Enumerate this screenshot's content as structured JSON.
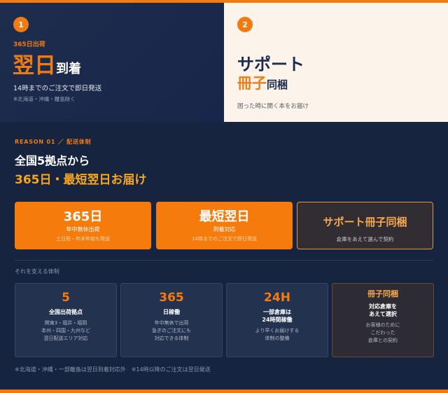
{
  "colors": {
    "accent": "#f07b12",
    "navy": "#16243f",
    "cream": "#fcf4ea",
    "gold": "#f5a623"
  },
  "panel_left": {
    "number": "1",
    "small": "365日出荷",
    "big_accent": "翌日",
    "big_rest": "到着",
    "sub": "14時までのご注文で即日発送",
    "note": "※北海道・沖縄・離島除く"
  },
  "panel_right": {
    "number": "2",
    "line1": "サポート",
    "line2_accent": "冊子",
    "line2_rest": "同梱",
    "sub": "困った時に開く本をお届け"
  },
  "reason": {
    "label": "REASON 01 ／ 配送体制",
    "heading1": "全国5拠点から",
    "heading2": "365日・最短翌日お届け"
  },
  "cards": [
    {
      "title": "365日",
      "line1": "年中無休出荷",
      "line2": "土日祝・年末年始も発送"
    },
    {
      "title": "最短翌日",
      "line1": "到着対応",
      "line2": "14時までのご注文で即日発送"
    },
    {
      "title": "サポート冊子同梱",
      "line1": "倉庫をあえて選んで契約"
    }
  ],
  "support_label": "それを支える体制",
  "boxes": [
    {
      "title": "5",
      "subtitle": "全国出荷拠点",
      "desc": [
        "関東3・福井・福岡",
        "本州・四国・九州など",
        "翌日配送エリア対応"
      ]
    },
    {
      "title": "365",
      "subtitle": "日稼働",
      "desc": [
        "年中無休で出荷",
        "急ぎのご注文にも",
        "対応できる体制"
      ]
    },
    {
      "title": "24H",
      "subtitle": "一部倉庫は",
      "subtitle2": "24時間稼働",
      "desc": [
        "より早くお届けする",
        "体制の整備"
      ]
    },
    {
      "title": "冊子同梱",
      "subtitle": "対応倉庫を",
      "subtitle2": "あえて選択",
      "desc": [
        "お客様のために",
        "こだわった",
        "倉庫との契約"
      ]
    }
  ],
  "footnote": "※北海道・沖縄・一部離島は翌日到着対応外　※14時以降のご注文は翌日発送"
}
